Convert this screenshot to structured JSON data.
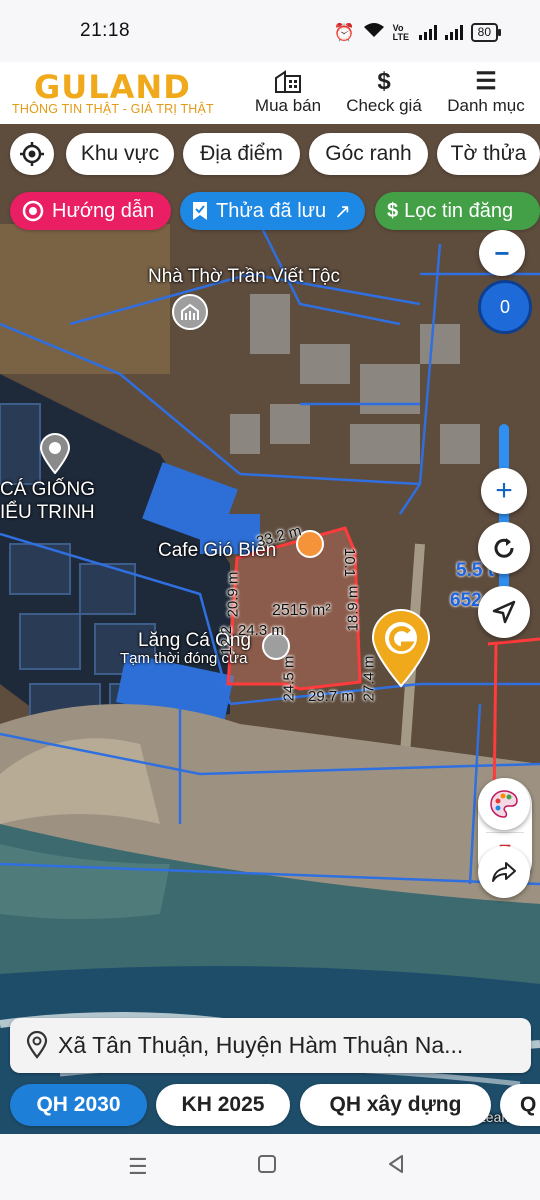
{
  "status_bar": {
    "time": "21:18",
    "volte": "Vo LTE",
    "battery": "80"
  },
  "header": {
    "logo": "GULAND",
    "tagline": "THÔNG TIN THẬT - GIÁ TRỊ THẬT",
    "nav": [
      {
        "icon": "building-icon",
        "label": "Mua bán"
      },
      {
        "icon": "dollar-icon",
        "label": "Check giá"
      },
      {
        "icon": "menu-icon",
        "label": "Danh mục"
      }
    ]
  },
  "filters": {
    "row1": [
      "Khu vực",
      "Địa điểm",
      "Góc ranh",
      "Tờ thửa"
    ],
    "guide": "Hướng dẫn",
    "saved": "Thửa đã lưu",
    "filter": "Lọc tin đăng"
  },
  "map": {
    "labels": {
      "church": "Nhà Thờ Trần Viết Tộc",
      "fish_1": "CÁ GIỐNG",
      "fish_2": "IỂU TRINH",
      "cafe": "Cafe Gió Biển",
      "mausoleum": "Lăng Cá Ông",
      "closed": "Tạm thời đóng cửa",
      "right_value_1": "5.5 t",
      "right_value_2": "652",
      "watermark": "Lean"
    },
    "plot": {
      "area": "2515 m²",
      "dims": [
        "33.2 m",
        "10.1",
        "18.9 m",
        "20.9 m",
        "12.2",
        "24.3 m",
        "24.5 m",
        "29.7 m",
        "27.4 m"
      ]
    },
    "zoom_value": "0"
  },
  "search": {
    "value": "Xã Tân Thuận, Huyện Hàm Thuận Na..."
  },
  "tabs": [
    "QH 2030",
    "KH 2025",
    "QH xây dựng",
    "Q"
  ],
  "colors": {
    "brand": "#f0a91a",
    "guide": "#e91e63",
    "saved": "#1e88e5",
    "filter": "#43a047",
    "plot_outline": "#ff4d4d",
    "active_tab": "#1e7fd8"
  }
}
